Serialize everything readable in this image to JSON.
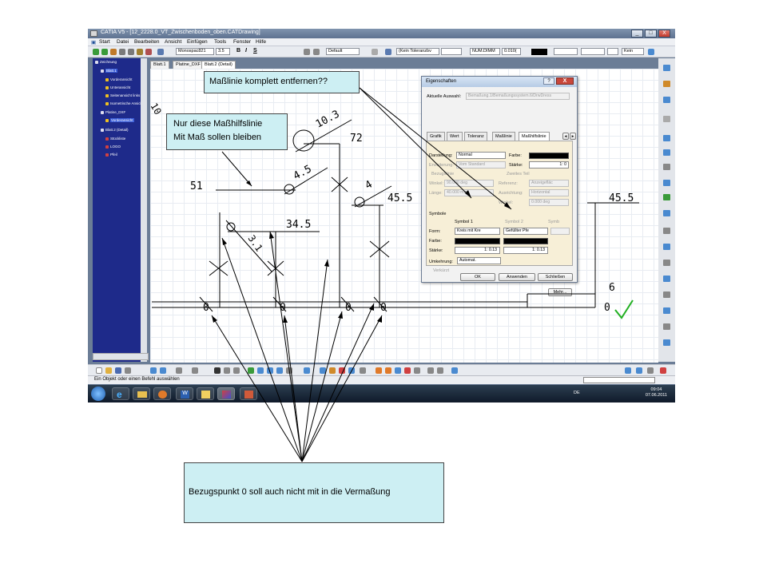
{
  "window": {
    "title": "CATIA V5 - [12_2228.0_VT_Zwischenboden_oben.CATDrawing]",
    "controls": [
      "_",
      "□",
      "X"
    ]
  },
  "menu": [
    "Start",
    "Datei",
    "Bearbeiten",
    "Ansicht",
    "Einfügen",
    "Tools",
    "Fenster",
    "Hilfe"
  ],
  "toolbar": {
    "font": "Monospac821",
    "size": "3.5",
    "bold": "B",
    "italic": "I",
    "underline": "S",
    "style": "Default",
    "tolerance": "(Kein Toleranzbv",
    "numeric": "NUM.DIMM",
    "precision": "0.010(",
    "line_none": "Kein"
  },
  "tree": {
    "items": [
      "Zeichnung",
      "Blatt.1",
      "Vorderansicht",
      "Unteransicht",
      "Seitenansicht links",
      "Isometrische Ansicht",
      "Platine_DXF",
      "Vorderansicht",
      "Blatt.2 (Detail)",
      "Stückliste",
      "LOGO",
      "Pfeil"
    ]
  },
  "sheet_tabs": [
    "Blatt.1",
    "Platine_DXF",
    "Blatt.2 (Detail)"
  ],
  "drawing": {
    "dims": [
      "10",
      "10.3",
      "72",
      "4.5",
      "51",
      "4",
      "45.5",
      "34.5",
      "3.1",
      "45.5",
      "6"
    ],
    "zeros": [
      "0",
      "0",
      "0",
      "0",
      "0"
    ]
  },
  "dialog": {
    "title": "Eigenschaften",
    "help": "?",
    "close": "X",
    "current_label": "Aktuelle Auswahl:",
    "current_value": "Bemaßung.1/Bemaßungssystem.6/DrwDress",
    "tabs": [
      "Grafik",
      "Wert",
      "Toleranz",
      "Maßlinie",
      "Maßhilfslinie"
    ],
    "darstellung_label": "Darstellung:",
    "darstellung_value": "Normal",
    "farbe_label": "Farbe:",
    "erweiterung_label": "Erweiterung:",
    "erweiterung_value": "Vom Standard",
    "staerke_label": "Stärke:",
    "staerke_value": "1: 0",
    "bezug_label": "Bezugslinie",
    "zweites_label": "Zweites Teil",
    "winkel_label": "Winkel:",
    "winkel_value": "90.000 deg",
    "referenz_label": "Referenz:",
    "referenz_value": "Anzeigefläc",
    "laenge_label": "Länge:",
    "laenge_value": "40.000 mm",
    "ausrichtung_label": "Ausrichtung:",
    "ausrichtung_value": "Horizontal",
    "winkel2_label": "Winkel:",
    "winkel2_value": "0.000 deg",
    "symbole_label": "Symbole",
    "symbol1_label": "Symbol 1",
    "symbol2_label": "Symbol 2",
    "symbol3_label": "Symb",
    "form_label": "Form:",
    "form1_value": "Kreis mit Kre",
    "form2_value": "Gefüllter Pfe",
    "farbe2_label": "Farbe:",
    "staerke2_label": "Stärke:",
    "staerke2_v1": "1: 0.13",
    "staerke2_v2": "1: 0.13",
    "umkehrung_label": "Umkehrung:",
    "umkehrung_value": "Automat.",
    "verkuerzt_label": "Verkürzt",
    "mehr": "Mehr...",
    "ok": "OK",
    "anwenden": "Anwenden",
    "schliessen": "Schließen"
  },
  "status": {
    "text": "Ein Objekt oder einen Befehl auswählen"
  },
  "taskbar": {
    "lang": "DE",
    "time": "09:04",
    "date": "07.06.2011"
  },
  "callouts": {
    "masslinie": "Maßlinie komplett entfernen??",
    "masshilfs_line1": "Nur diese Maßhilfslinie",
    "masshilfs_line2": "Mit Maß sollen bleiben",
    "bezugspunkt": "Bezugspunkt 0 soll auch nicht mit in die Vermaßung"
  },
  "colors": {
    "callout_fill": "#cdeff3",
    "tree_bg": "#1e2a8a",
    "checkmark": "#22b022"
  }
}
